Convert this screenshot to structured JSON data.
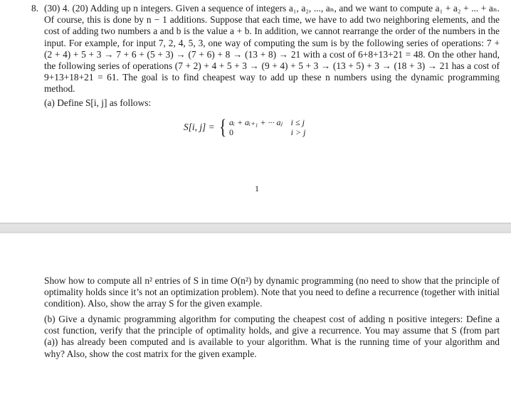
{
  "document": {
    "page1": {
      "question_number": "8.",
      "intro_paragraph": "(30) 4. (20) Adding up n integers. Given a sequence of integers a₁, a₂, ..., aₙ, and we want to compute a₁ + a₂ + ... + aₙ. Of course, this is done by n − 1 additions. Suppose that each time, we have to add two neighboring elements, and the cost of adding two numbers a and b is the value a + b. In addition, we cannot rearrange the order of the numbers in the input. For example, for input 7, 2, 4, 5, 3, one way of computing the sum is by the following series of operations: 7 + (2 + 4) + 5 + 3 → 7 + 6 + (5 + 3) → (7 + 6) + 8 → (13 + 8) → 21 with a cost of 6+8+13+21 = 48. On the other hand, the following series of operations (7 + 2) + 4 + 5 + 3 → (9 + 4) + 5 + 3 → (13 + 5) + 3 → (18 + 3) → 21 has a cost of 9+13+18+21 = 61. The goal is to find cheapest way to add up these n numbers using the dynamic programming method.",
      "part_a_heading": "(a) Define S[i, j] as follows:",
      "formula": {
        "lhs": "S[i, j] =",
        "brace": "{",
        "cases": [
          {
            "expr": "aᵢ + aᵢ₊₁ + ··· aⱼ",
            "cond": "i ≤ j"
          },
          {
            "expr": "0",
            "cond": "i > j"
          }
        ]
      },
      "page_number": "1"
    },
    "page2": {
      "part_a_body": "Show how to compute all n² entries of S in time O(n²) by dynamic programming (no need to show that the principle of optimality holds since it’s not an optimization problem). Note that you need to define a recurrence (together with initial condition). Also, show the array S for the given example.",
      "part_b": "(b) Give a dynamic programming algorithm for computing the cheapest cost of adding n positive integers: Define a cost function, verify that the principle of optimality holds, and give a recurrence. You may assume that S (from part (a)) has already been computed and is available to your algorithm. What is the running time of your algorithm and why? Also, show the cost matrix for the given example."
    }
  }
}
